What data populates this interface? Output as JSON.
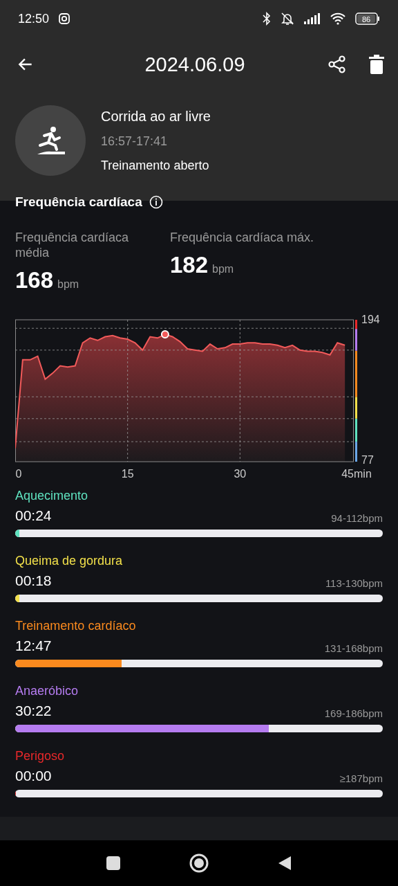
{
  "status_bar": {
    "time": "12:50",
    "battery": "86"
  },
  "toolbar": {
    "title": "2024.06.09"
  },
  "activity": {
    "name": "Corrida ao ar livre",
    "time_range": "16:57-17:41",
    "mode": "Treinamento aberto"
  },
  "heart_rate": {
    "title": "Frequência cardíaca",
    "stats": [
      {
        "label": "Frequência cardíaca média",
        "value": "168",
        "unit": "bpm"
      },
      {
        "label": "Frequência cardíaca máx.",
        "value": "182",
        "unit": "bpm"
      }
    ],
    "chart_data": {
      "type": "area",
      "x": [
        0,
        1,
        2,
        3,
        4,
        5,
        6,
        7,
        8,
        9,
        10,
        11,
        12,
        13,
        14,
        15,
        16,
        17,
        18,
        19,
        20,
        21,
        22,
        23,
        24,
        25,
        26,
        27,
        28,
        29,
        30,
        31,
        32,
        33,
        34,
        35,
        36,
        37,
        38,
        39,
        40,
        41,
        42,
        43,
        44
      ],
      "series": [
        {
          "color": "#f25a5a",
          "values": [
            88,
            161,
            161,
            164,
            145,
            150,
            156,
            155,
            156,
            175,
            179,
            177,
            180,
            181,
            179,
            178,
            175,
            169,
            180,
            179,
            182,
            180,
            176,
            170,
            169,
            168,
            174,
            170,
            171,
            174,
            174,
            175,
            175,
            174,
            174,
            173,
            171,
            173,
            169,
            168,
            168,
            167,
            165,
            175,
            173
          ]
        }
      ],
      "xlim": [
        0,
        45
      ],
      "ylim": [
        77,
        194
      ],
      "xticks": [
        0,
        15,
        30,
        {
          "value": 45,
          "label": "45min"
        }
      ],
      "yticks": [
        77,
        194
      ]
    },
    "zones": [
      {
        "name": "Aquecimento",
        "color": "#5fe3c0",
        "time": "00:24",
        "range": "94-112bpm",
        "level": 0.01
      },
      {
        "name": "Queima de gordura",
        "color": "#f2e04a",
        "time": "00:18",
        "range": "113-130bpm",
        "level": 0.008
      },
      {
        "name": "Treinamento cardíaco",
        "color": "#fb8a1e",
        "time": "12:47",
        "range": "131-168bpm",
        "level": 0.29
      },
      {
        "name": "Anaeróbico",
        "color": "#b57cf0",
        "time": "30:22",
        "range": "169-186bpm",
        "level": 0.69
      },
      {
        "name": "Perigoso",
        "color": "#e8282a",
        "time": "00:00",
        "range": "≥187bpm",
        "level": 0
      }
    ]
  }
}
